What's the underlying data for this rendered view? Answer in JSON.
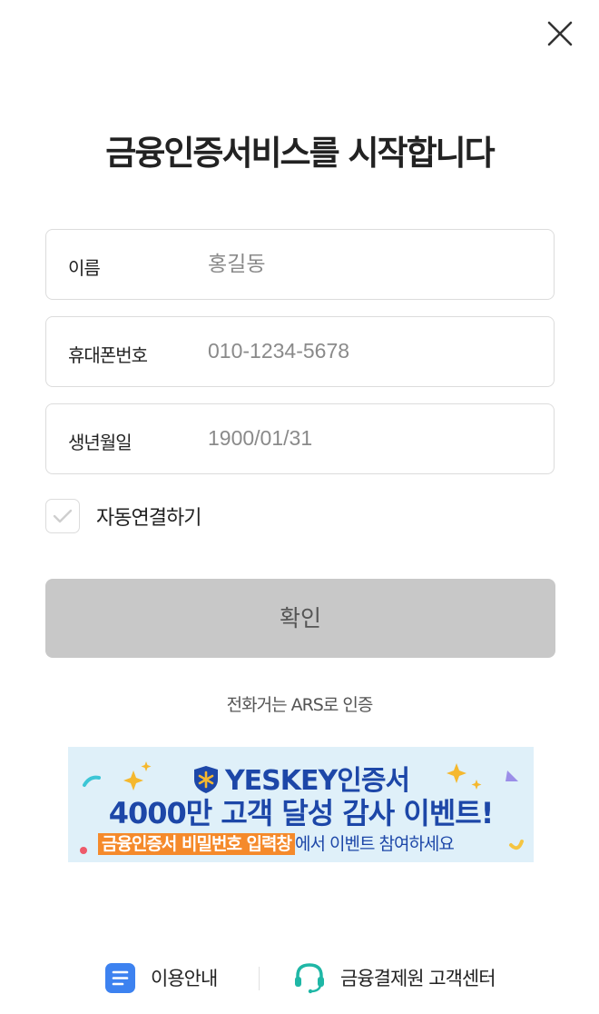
{
  "header": {
    "close_icon": "close-icon"
  },
  "title": "금융인증서비스를 시작합니다",
  "form": {
    "name": {
      "label": "이름",
      "placeholder": "홍길동"
    },
    "phone": {
      "label": "휴대폰번호",
      "placeholder": "010-1234-5678"
    },
    "birth": {
      "label": "생년월일",
      "placeholder": "1900/01/31"
    },
    "auto_connect": {
      "label": "자동연결하기",
      "checked": false
    }
  },
  "confirm_label": "확인",
  "ars_link": "전화거는 ARS로 인증",
  "banner": {
    "line1": "YESKEY인증서",
    "line2": "4000만 고객 달성 감사 이벤트!",
    "line3_highlight": "금융인증서 비밀번호 입력창",
    "line3_rest": "에서 이벤트 참여하세요",
    "colors": {
      "background": "#dff0f9",
      "text": "#1d47a8",
      "highlight": "#f58a2b"
    }
  },
  "footer": {
    "guide": {
      "label": "이용안내",
      "icon": "document-icon"
    },
    "support": {
      "label": "금융결제원 고객센터",
      "icon": "headset-icon"
    }
  },
  "colors": {
    "button_disabled": "#c8c8c8",
    "border": "#dcdcdc",
    "guide_icon": "#3d82f0",
    "support_icon": "#1fb7a6"
  }
}
